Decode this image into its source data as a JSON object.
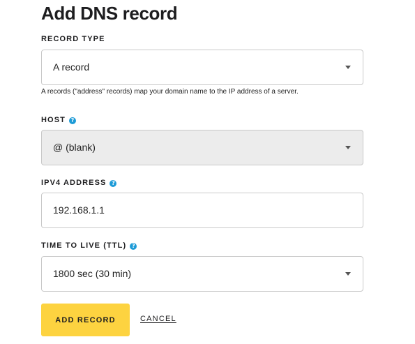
{
  "page": {
    "title": "Add DNS record"
  },
  "record_type": {
    "label": "RECORD TYPE",
    "value": "A record",
    "hint": "A records (\"address\" records) map your domain name to the IP address of a server."
  },
  "host": {
    "label": "HOST",
    "help_icon": "?",
    "value": "@ (blank)"
  },
  "ipv4": {
    "label": "IPV4 ADDRESS",
    "help_icon": "?",
    "value": "192.168.1.1"
  },
  "ttl": {
    "label": "TIME TO LIVE (TTL)",
    "help_icon": "?",
    "value": "1800 sec (30 min)"
  },
  "actions": {
    "add_label": "ADD RECORD",
    "cancel_label": "CANCEL"
  },
  "colors": {
    "primary_button": "#fdd340",
    "help_icon": "#1d9bd7",
    "disabled_field": "#ececec",
    "border": "#c9c9c9"
  },
  "icons": {
    "dropdown": "caret-down-icon",
    "help": "question-circle-icon"
  }
}
